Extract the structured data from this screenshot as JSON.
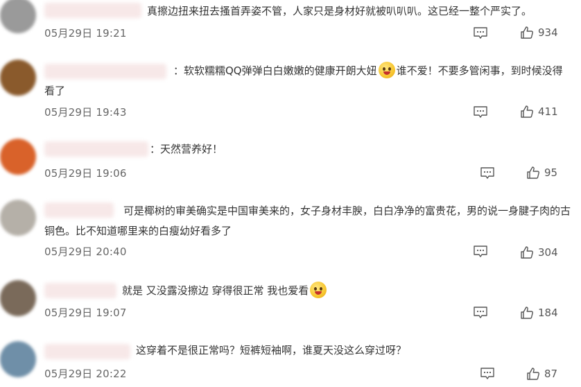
{
  "comments": [
    {
      "text": "真擦边扭来扭去搔首弄姿不管，人家只是身材好就被叭叭叭。这已经一整个严实了。",
      "time": "05月29日 19:21",
      "likes": "934",
      "avatar_color": "#9a9a9a"
    },
    {
      "text_before_emoji": "：软软糯糯QQ弹弹白白嫩嫩的健康开朗大妞",
      "emoji": "heart-eyes-emoji",
      "text_after_emoji": "谁不爱！不要多管闲事，到时候没得看了",
      "time": "05月29日 19:43",
      "likes": "411",
      "avatar_color": "#8a5a2c"
    },
    {
      "text": "：天然营养好！",
      "time": "05月29日 19:06",
      "likes": "95",
      "avatar_color": "#d9622a"
    },
    {
      "text": "可是椰树的审美确实是中国审美来的，女子身材丰腴，白白净净的富贵花，男的说一身腱子肉的古铜色。比不知道哪里来的白瘦幼好看多了",
      "time": "05月29日 20:40",
      "likes": "304",
      "avatar_color": "#b5b0a8"
    },
    {
      "text_before_emoji": "就是 又没露没擦边 穿得很正常 我也爱看",
      "emoji": "laughing-emoji",
      "text_after_emoji": "",
      "time": "05月29日 19:07",
      "likes": "184",
      "avatar_color": "#7a6a5a"
    },
    {
      "text": "这穿着不是很正常吗？短裤短袖啊，谁夏天没这么穿过呀？",
      "time": "05月29日 20:22",
      "likes": "87",
      "avatar_color": "#6f8fa8"
    }
  ]
}
